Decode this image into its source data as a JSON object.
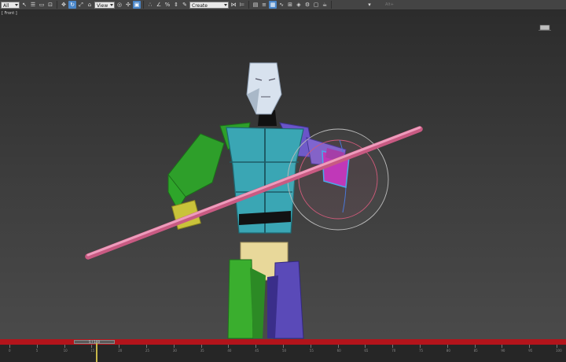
{
  "toolbar": {
    "selection_filter": "All",
    "reference_coord": "View",
    "named_selection": "Create Selection Se",
    "workspace": "Alt+",
    "icons": [
      "undo-icon",
      "redo-icon",
      "link-icon",
      "unlink-icon",
      "bind-space-warp-icon",
      "select-object-icon",
      "select-by-name-icon",
      "rectangular-selection-icon",
      "window-crossing-icon",
      "select-move-icon",
      "select-rotate-icon",
      "select-scale-icon",
      "select-place-icon",
      "use-pivot-center-icon",
      "select-manipulate-icon",
      "keyboard-shortcut-override-icon",
      "snaps-toggle-icon",
      "angle-snap-icon",
      "percent-snap-icon",
      "spinner-snap-icon",
      "edit-named-selection-icon",
      "mirror-icon",
      "align-icon",
      "toggle-scene-explorer-icon",
      "toggle-layer-explorer-icon",
      "toggle-ribbon-icon",
      "curve-editor-icon",
      "schematic-view-icon",
      "material-editor-icon",
      "render-setup-icon",
      "rendered-frame-window-icon",
      "render-production-icon"
    ]
  },
  "viewport": {
    "label": "[ Front ]"
  },
  "colors": {
    "head": "#d8e2ee",
    "torso": "#3aa6b4",
    "left_arm": "#2e9f2a",
    "right_arm": "#6a55c8",
    "pelvis": "#e8d89a",
    "left_leg": "#3aae2e",
    "right_leg": "#5a4ab8",
    "staff": "#e07ea2",
    "timeline": "#b3141b",
    "selection": "#4aa8e8"
  },
  "timeline": {
    "slider_text": "5 / 100",
    "tick_labels": [
      "0",
      "5",
      "10",
      "15",
      "20",
      "25",
      "30",
      "35",
      "40",
      "45",
      "50",
      "55",
      "60",
      "65",
      "70",
      "75",
      "80",
      "85",
      "90",
      "95",
      "100"
    ]
  }
}
